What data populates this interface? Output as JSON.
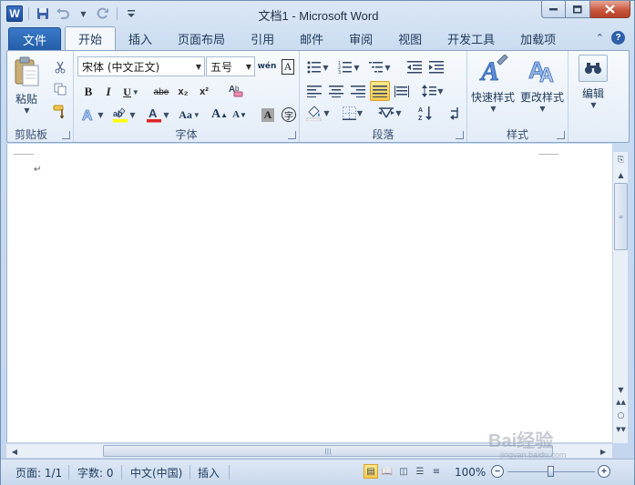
{
  "titlebar": {
    "app_icon": "W",
    "title": "文档1  -  Microsoft Word",
    "qat_icons": [
      "save-icon",
      "undo-icon",
      "redo-icon",
      "customize-qat-icon"
    ],
    "min_glyph": "▬",
    "max_glyph": "▢",
    "close_glyph": "✕"
  },
  "tabs": {
    "file": "文件",
    "home": "开始",
    "insert": "插入",
    "layout": "页面布局",
    "references": "引用",
    "mailings": "邮件",
    "review": "审阅",
    "view": "视图",
    "developer": "开发工具",
    "addins": "加载项",
    "help_glyph": "?",
    "collapse_glyph": "⌃"
  },
  "clipboard": {
    "label": "剪贴板",
    "paste": "粘贴"
  },
  "font": {
    "label": "字体",
    "font_name": "宋体 (中文正文)",
    "font_size": "五号",
    "bold": "B",
    "italic": "I",
    "underline": "U",
    "strike": "abe",
    "subscript": "x₂",
    "superscript": "x²",
    "grow": "A",
    "shrink": "A",
    "case": "Aa",
    "phonetic": "wén",
    "char_border": "A",
    "shading": "A",
    "enclose": "字",
    "font_color_hex": "#e02424",
    "highlight_hex": "#ffff00"
  },
  "paragraph": {
    "label": "段落"
  },
  "styles": {
    "label": "样式",
    "quick": "快速样式",
    "change": "更改样式"
  },
  "editing": {
    "label": "编辑"
  },
  "document": {
    "para_mark": "↵"
  },
  "status": {
    "page": "页面: 1/1",
    "words": "字数: 0",
    "lang": "中文(中国)",
    "mode": "插入",
    "zoom": "100%"
  },
  "watermark": {
    "text": "Bai经验",
    "sub": "jingyan.baidu.com"
  }
}
